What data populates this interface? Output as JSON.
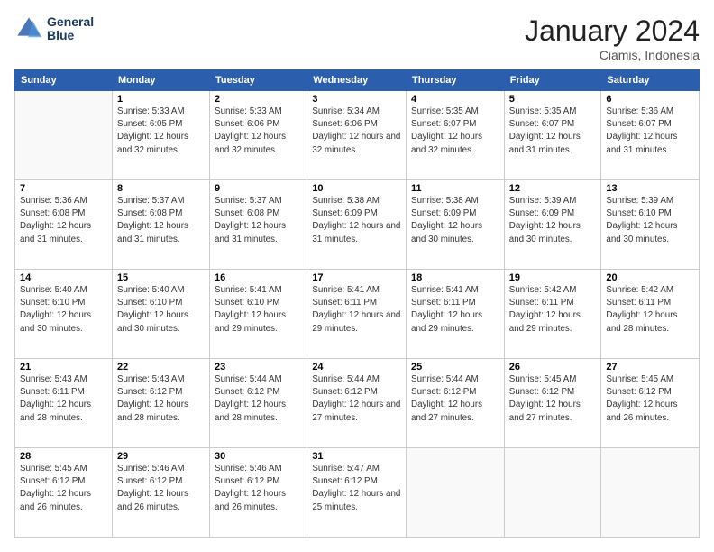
{
  "header": {
    "logo_line1": "General",
    "logo_line2": "Blue",
    "month_title": "January 2024",
    "location": "Ciamis, Indonesia"
  },
  "weekdays": [
    "Sunday",
    "Monday",
    "Tuesday",
    "Wednesday",
    "Thursday",
    "Friday",
    "Saturday"
  ],
  "weeks": [
    [
      {
        "day": "",
        "empty": true
      },
      {
        "day": "1",
        "sunrise": "5:33 AM",
        "sunset": "6:05 PM",
        "daylight": "12 hours and 32 minutes."
      },
      {
        "day": "2",
        "sunrise": "5:33 AM",
        "sunset": "6:06 PM",
        "daylight": "12 hours and 32 minutes."
      },
      {
        "day": "3",
        "sunrise": "5:34 AM",
        "sunset": "6:06 PM",
        "daylight": "12 hours and 32 minutes."
      },
      {
        "day": "4",
        "sunrise": "5:35 AM",
        "sunset": "6:07 PM",
        "daylight": "12 hours and 32 minutes."
      },
      {
        "day": "5",
        "sunrise": "5:35 AM",
        "sunset": "6:07 PM",
        "daylight": "12 hours and 31 minutes."
      },
      {
        "day": "6",
        "sunrise": "5:36 AM",
        "sunset": "6:07 PM",
        "daylight": "12 hours and 31 minutes."
      }
    ],
    [
      {
        "day": "7",
        "sunrise": "5:36 AM",
        "sunset": "6:08 PM",
        "daylight": "12 hours and 31 minutes."
      },
      {
        "day": "8",
        "sunrise": "5:37 AM",
        "sunset": "6:08 PM",
        "daylight": "12 hours and 31 minutes."
      },
      {
        "day": "9",
        "sunrise": "5:37 AM",
        "sunset": "6:08 PM",
        "daylight": "12 hours and 31 minutes."
      },
      {
        "day": "10",
        "sunrise": "5:38 AM",
        "sunset": "6:09 PM",
        "daylight": "12 hours and 31 minutes."
      },
      {
        "day": "11",
        "sunrise": "5:38 AM",
        "sunset": "6:09 PM",
        "daylight": "12 hours and 30 minutes."
      },
      {
        "day": "12",
        "sunrise": "5:39 AM",
        "sunset": "6:09 PM",
        "daylight": "12 hours and 30 minutes."
      },
      {
        "day": "13",
        "sunrise": "5:39 AM",
        "sunset": "6:10 PM",
        "daylight": "12 hours and 30 minutes."
      }
    ],
    [
      {
        "day": "14",
        "sunrise": "5:40 AM",
        "sunset": "6:10 PM",
        "daylight": "12 hours and 30 minutes."
      },
      {
        "day": "15",
        "sunrise": "5:40 AM",
        "sunset": "6:10 PM",
        "daylight": "12 hours and 30 minutes."
      },
      {
        "day": "16",
        "sunrise": "5:41 AM",
        "sunset": "6:10 PM",
        "daylight": "12 hours and 29 minutes."
      },
      {
        "day": "17",
        "sunrise": "5:41 AM",
        "sunset": "6:11 PM",
        "daylight": "12 hours and 29 minutes."
      },
      {
        "day": "18",
        "sunrise": "5:41 AM",
        "sunset": "6:11 PM",
        "daylight": "12 hours and 29 minutes."
      },
      {
        "day": "19",
        "sunrise": "5:42 AM",
        "sunset": "6:11 PM",
        "daylight": "12 hours and 29 minutes."
      },
      {
        "day": "20",
        "sunrise": "5:42 AM",
        "sunset": "6:11 PM",
        "daylight": "12 hours and 28 minutes."
      }
    ],
    [
      {
        "day": "21",
        "sunrise": "5:43 AM",
        "sunset": "6:11 PM",
        "daylight": "12 hours and 28 minutes."
      },
      {
        "day": "22",
        "sunrise": "5:43 AM",
        "sunset": "6:12 PM",
        "daylight": "12 hours and 28 minutes."
      },
      {
        "day": "23",
        "sunrise": "5:44 AM",
        "sunset": "6:12 PM",
        "daylight": "12 hours and 28 minutes."
      },
      {
        "day": "24",
        "sunrise": "5:44 AM",
        "sunset": "6:12 PM",
        "daylight": "12 hours and 27 minutes."
      },
      {
        "day": "25",
        "sunrise": "5:44 AM",
        "sunset": "6:12 PM",
        "daylight": "12 hours and 27 minutes."
      },
      {
        "day": "26",
        "sunrise": "5:45 AM",
        "sunset": "6:12 PM",
        "daylight": "12 hours and 27 minutes."
      },
      {
        "day": "27",
        "sunrise": "5:45 AM",
        "sunset": "6:12 PM",
        "daylight": "12 hours and 26 minutes."
      }
    ],
    [
      {
        "day": "28",
        "sunrise": "5:45 AM",
        "sunset": "6:12 PM",
        "daylight": "12 hours and 26 minutes."
      },
      {
        "day": "29",
        "sunrise": "5:46 AM",
        "sunset": "6:12 PM",
        "daylight": "12 hours and 26 minutes."
      },
      {
        "day": "30",
        "sunrise": "5:46 AM",
        "sunset": "6:12 PM",
        "daylight": "12 hours and 26 minutes."
      },
      {
        "day": "31",
        "sunrise": "5:47 AM",
        "sunset": "6:12 PM",
        "daylight": "12 hours and 25 minutes."
      },
      {
        "day": "",
        "empty": true
      },
      {
        "day": "",
        "empty": true
      },
      {
        "day": "",
        "empty": true
      }
    ]
  ]
}
